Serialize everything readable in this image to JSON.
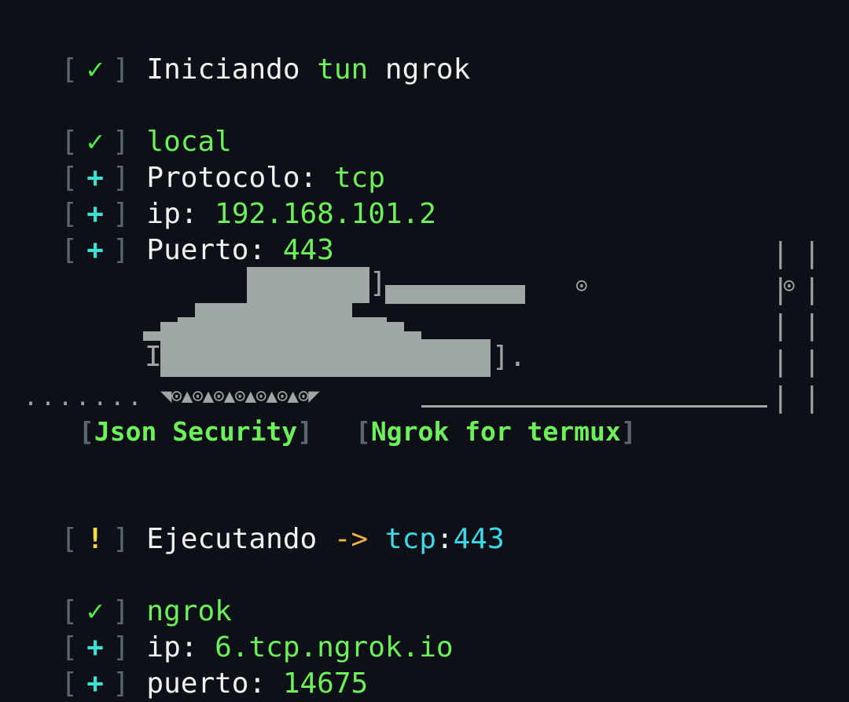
{
  "colors": {
    "background": "#0d1117",
    "bracket": "#5b6670",
    "check": "#54e84c",
    "plus": "#3ee0d0",
    "warning": "#f5d94a",
    "value_green": "#6df05c",
    "value_cyan": "#3fd8e8",
    "arrow": "#f0b24a",
    "art_gray": "#9ea6a6"
  },
  "glyphs": {
    "open": "[",
    "close": "]",
    "check": "✓",
    "plus": "+",
    "warn": "!"
  },
  "start": {
    "label": "Iniciando",
    "value": "tun",
    "tail": "ngrok"
  },
  "local": {
    "title": "local",
    "protocol_label": "Protocolo:",
    "protocol_value": "tcp",
    "ip_label": "ip:",
    "ip_value": "192.168.101.2",
    "port_label": "Puerto:",
    "port_value": "443"
  },
  "banner": {
    "left": "Json Security",
    "right": "Ngrok for termux"
  },
  "running": {
    "label": "Ejecutando",
    "arrow": "->",
    "protocol": "tcp",
    "separator": ":",
    "port": "443"
  },
  "ngrok": {
    "title": "ngrok",
    "ip_label": "ip:",
    "ip_value": "6.tcp.ngrok.io",
    "port_label": "puerto:",
    "port_value": "14675"
  }
}
